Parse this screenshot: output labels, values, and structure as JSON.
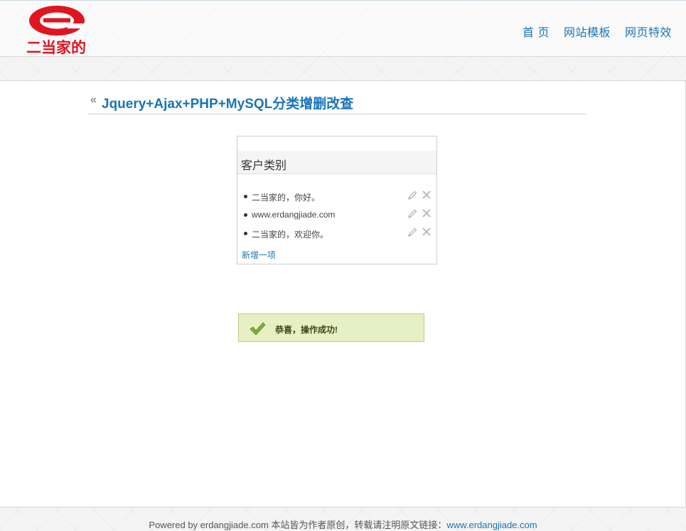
{
  "header": {
    "logo_text": "二当家的",
    "nav": [
      {
        "label": "首 页"
      },
      {
        "label": "网站模板"
      },
      {
        "label": "网页特效"
      }
    ]
  },
  "page": {
    "back_glyph": "«",
    "title": "Jquery+Ajax+PHP+MySQL分类增删改查"
  },
  "panel": {
    "title": "客户类别",
    "items": [
      {
        "text": "二当家的，你好。"
      },
      {
        "text": "www.erdangjiade.com"
      },
      {
        "text": "二当家的，欢迎你。"
      }
    ],
    "add_label": "新增一项"
  },
  "message": {
    "text": "恭喜，操作成功!"
  },
  "footer": {
    "text": "Powered by erdangjiade.com 本站皆为作者原创，转载请注明原文链接：",
    "link": "www.erdangjiade.com"
  },
  "colors": {
    "brand_red": "#e0151f",
    "link_blue": "#1a74b8",
    "success_bg": "#e6f0c4"
  }
}
